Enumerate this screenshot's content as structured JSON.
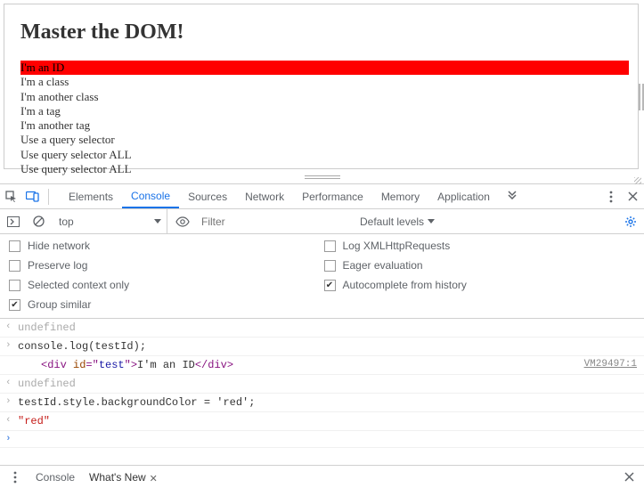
{
  "page": {
    "heading": "Master the DOM!",
    "lines": [
      "I'm an ID",
      "I'm a class",
      "I'm another class",
      "I'm a tag",
      "I'm another tag",
      "Use a query selector",
      "Use query selector ALL",
      "Use query selector ALL"
    ]
  },
  "devtools": {
    "tabs": [
      "Elements",
      "Console",
      "Sources",
      "Network",
      "Performance",
      "Memory",
      "Application"
    ],
    "activeTab": "Console",
    "contextLabel": "top",
    "filterPlaceholder": "Filter",
    "levelsLabel": "Default levels",
    "settings": {
      "hideNetwork": "Hide network",
      "logXHR": "Log XMLHttpRequests",
      "preserveLog": "Preserve log",
      "eagerEval": "Eager evaluation",
      "selectedContextOnly": "Selected context only",
      "autocomplete": "Autocomplete from history",
      "groupSimilar": "Group similar"
    },
    "console": {
      "r0": "undefined",
      "r1": "console.log(testId);",
      "r2_open": "<div ",
      "r2_attrn": "id",
      "r2_eq": "=\"",
      "r2_attrv": "test",
      "r2_close1": "\">",
      "r2_text": "I'm an ID",
      "r2_end": "</div>",
      "r2_src": "VM29497:1",
      "r3": "undefined",
      "r4": "testId.style.backgroundColor = 'red';",
      "r5": "\"red\""
    },
    "drawer": {
      "console": "Console",
      "whatsnew": "What's New"
    }
  }
}
